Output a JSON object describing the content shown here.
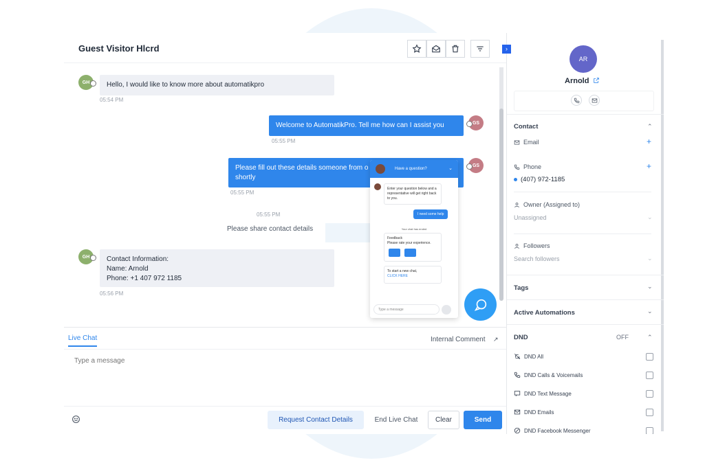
{
  "chat": {
    "title": "Guest Visitor Hlcrd",
    "messages": [
      {
        "from": "visitor",
        "avatar": "GH",
        "text": "Hello, I would like to know more about automatikpro",
        "time": "05:54 PM"
      },
      {
        "from": "agent",
        "avatar": "GS",
        "text": "Welcome to AutomatikPro. Tell me how can I assist you",
        "time": "05:55 PM"
      },
      {
        "from": "agent",
        "avatar": "GS",
        "text_line1": "Please fill out these details someone from o",
        "text_line2": "shortly",
        "time": "05:55 PM"
      }
    ],
    "system": {
      "time": "05:55 PM",
      "text": "Please share contact details"
    },
    "contact_info": {
      "avatar": "GH",
      "line1": "Contact Information:",
      "line2": "Name: Arnold",
      "line3": "Phone: +1 407 972 1185",
      "time": "05:56 PM"
    }
  },
  "widget": {
    "header": "Have a question?",
    "bot_message": "Enter your question below and a representative will get right back to you.",
    "user_message": "I need some help",
    "ended": "Your chat has ended",
    "feedback_title": "Feedback",
    "feedback_text": "Please rate your experience.",
    "new_chat_text": "To start a new chat,",
    "new_chat_link": "CLICK HERE",
    "input_placeholder": "Type a message"
  },
  "composer": {
    "tab_live_chat": "Live Chat",
    "tab_internal": "Internal Comment",
    "placeholder": "Type a message",
    "request_label": "Request Contact Details",
    "end_label": "End Live Chat",
    "clear_label": "Clear",
    "send_label": "Send"
  },
  "panel": {
    "avatar_initials": "AR",
    "name": "Arnold",
    "contact_section": "Contact",
    "email_label": "Email",
    "phone_label": "Phone",
    "phone_value": "(407) 972-1185",
    "owner_label": "Owner (Assigned to)",
    "owner_value": "Unassigned",
    "followers_label": "Followers",
    "followers_placeholder": "Search followers",
    "tags_section": "Tags",
    "automations_section": "Active Automations",
    "dnd_section": "DND",
    "dnd_state": "OFF",
    "dnd_items": [
      "DND All",
      "DND Calls & Voicemails",
      "DND Text Message",
      "DND Emails",
      "DND Facebook Messenger"
    ]
  },
  "colors": {
    "primary": "#2f86eb",
    "visitor_avatar": "#8db06c",
    "agent_avatar": "#c47c85",
    "contact_avatar": "#6366c9"
  },
  "icons": [
    "star-icon",
    "mail-open-icon",
    "trash-icon",
    "filter-icon",
    "chat-bubble-icon",
    "emoji-icon",
    "phone-icon",
    "envelope-icon",
    "external-link-icon",
    "user-icon",
    "bell-off-icon"
  ]
}
